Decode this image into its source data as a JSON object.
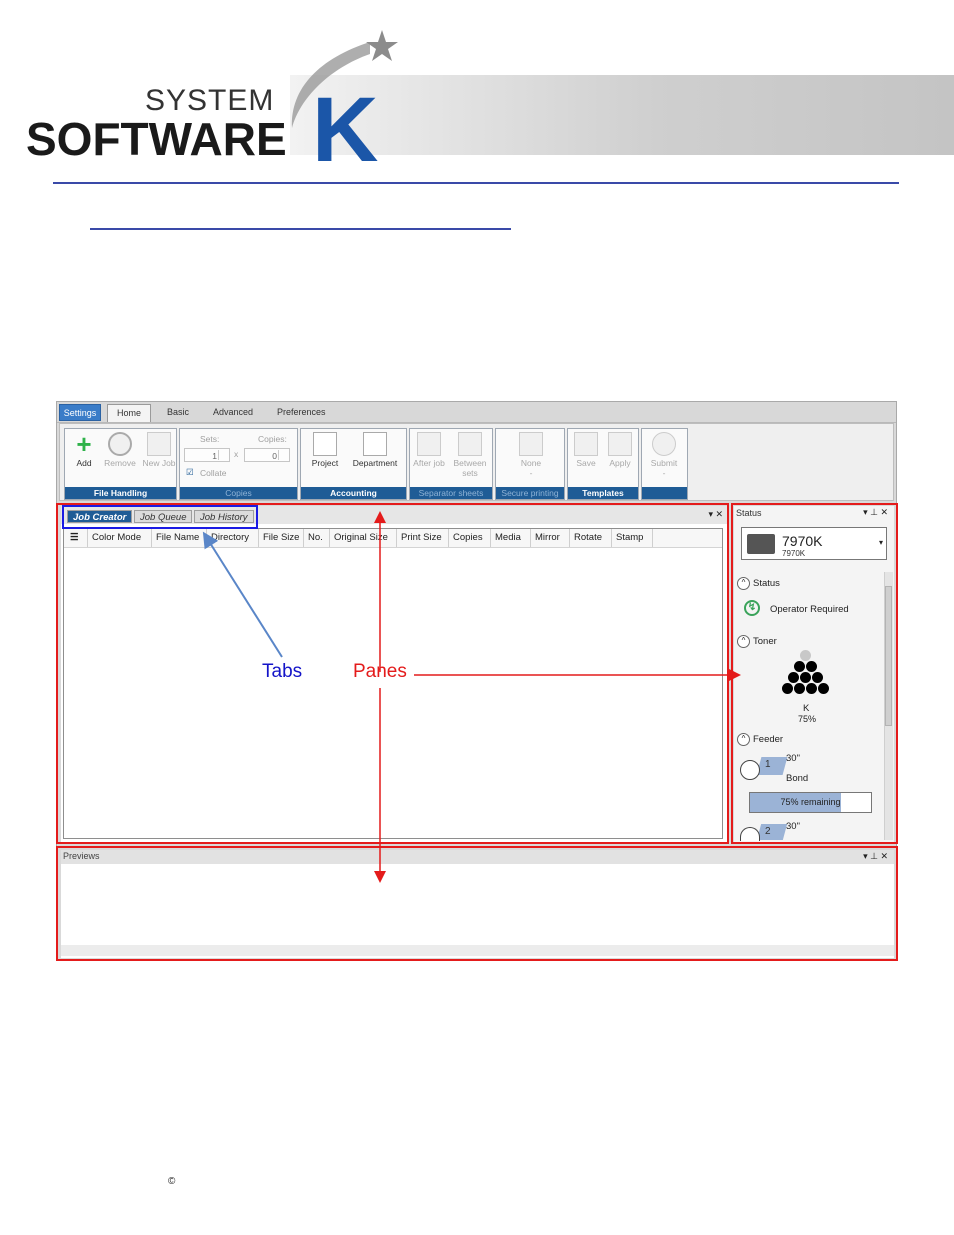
{
  "logo": {
    "system": "SYSTEM",
    "software": "SOFTWARE",
    "k": "K"
  },
  "app": {
    "menu": {
      "settings": "Settings",
      "home": "Home",
      "basic": "Basic",
      "advanced": "Advanced",
      "preferences": "Preferences"
    },
    "ribbon": {
      "file_handling": {
        "label": "File Handling",
        "add": "Add",
        "remove": "Remove",
        "new_job": "New Job"
      },
      "copies": {
        "label": "Copies",
        "sets_label": "Sets:",
        "sets_value": "1",
        "x": "x",
        "copies_label": "Copies:",
        "copies_value": "0",
        "collate": "Collate"
      },
      "accounting": {
        "label": "Accounting",
        "project": "Project",
        "department": "Department"
      },
      "separator_sheets": {
        "label": "Separator sheets",
        "after_job": "After job",
        "between_sets": "Between sets"
      },
      "secure_printing": {
        "label": "Secure printing",
        "none": "None",
        "dash": "-"
      },
      "templates": {
        "label": "Templates",
        "save": "Save",
        "apply": "Apply"
      },
      "submit": {
        "label": "Submit",
        "dash": "-"
      }
    },
    "job_pane": {
      "tabs": [
        "Job Creator",
        "Job Queue",
        "Job History"
      ],
      "controls": "▾ ✕",
      "columns": [
        "Color Mode",
        "File Name",
        "Directory",
        "File Size",
        "No.",
        "Original Size",
        "Print Size",
        "Copies",
        "Media",
        "Mirror",
        "Rotate",
        "Stamp"
      ]
    },
    "status_pane": {
      "title": "Status",
      "controls": "▾ ⊥ ✕",
      "printer_name": "7970K",
      "printer_sub": "7970K",
      "status_section": "Status",
      "status_text": "Operator Required",
      "toner_section": "Toner",
      "toner_label": "K",
      "toner_percent": "75%",
      "feeder_section": "Feeder",
      "roll1": {
        "number": "1",
        "size": "30\"",
        "media": "Bond"
      },
      "progress_text": "75% remaining",
      "progress_fraction": 0.75,
      "roll2": {
        "number": "2",
        "size": "30\""
      }
    },
    "previews": {
      "title": "Previews",
      "controls": "▾ ⊥ ✕"
    }
  },
  "annotations": {
    "tabs": "Tabs",
    "panes": "Panes"
  },
  "footer": {
    "copyright": "©"
  },
  "colors": {
    "annotation_red": "#e41b1b",
    "annotation_blue": "#1b1be4",
    "accent_blue": "#1f5c96",
    "rule_blue": "#3a4aa8"
  }
}
